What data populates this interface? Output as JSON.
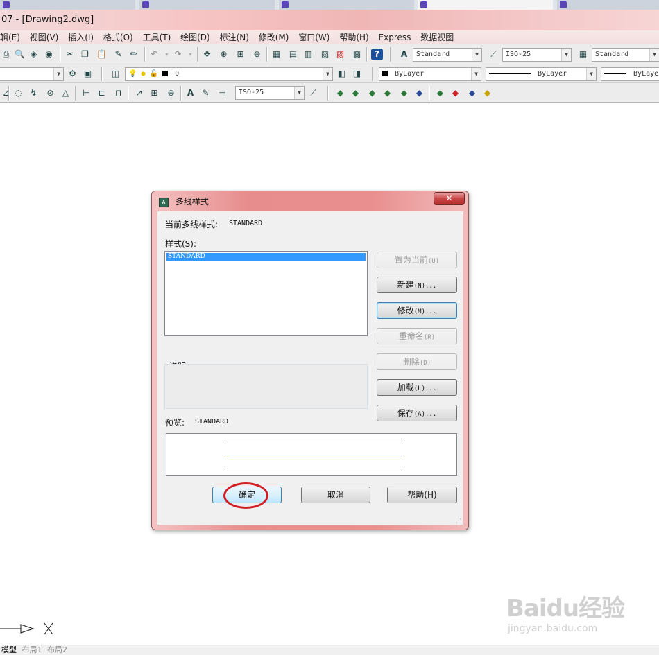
{
  "browser_tabs": [
    {
      "label": "",
      "active": false
    },
    {
      "label": "",
      "active": false
    },
    {
      "label": "",
      "active": false
    },
    {
      "label": "",
      "active": true
    },
    {
      "label": "",
      "active": false
    }
  ],
  "window": {
    "title": "07 - [Drawing2.dwg]"
  },
  "menu": [
    "辑(E)",
    "视图(V)",
    "插入(I)",
    "格式(O)",
    "工具(T)",
    "绘图(D)",
    "标注(N)",
    "修改(M)",
    "窗口(W)",
    "帮助(H)",
    "Express",
    "数据视图"
  ],
  "toolbar": {
    "text_style": "Standard",
    "dim_style": "ISO-25",
    "table_style": "Standard",
    "layer": "0",
    "color": "ByLayer",
    "linetype": "ByLayer",
    "lineweight": "ByLayer",
    "dim_style_2": "ISO-25"
  },
  "dialog": {
    "title": "多线样式",
    "close_glyph": "✕",
    "current_style_label": "当前多线样式:",
    "current_style_value": "STANDARD",
    "styles_label": "样式(S):",
    "styles": [
      "STANDARD"
    ],
    "description_label": "说明:",
    "preview_label": "预览:",
    "preview_value": "STANDARD",
    "buttons": {
      "set_current": {
        "label": "置为当前",
        "acc": "(U)"
      },
      "new": {
        "label": "新建",
        "acc": "(N)..."
      },
      "modify": {
        "label": "修改",
        "acc": "(M)..."
      },
      "rename": {
        "label": "重命名",
        "acc": "(R)"
      },
      "delete": {
        "label": "删除",
        "acc": "(D)"
      },
      "load": {
        "label": "加载",
        "acc": "(L)..."
      },
      "save": {
        "label": "保存",
        "acc": "(A)..."
      },
      "ok": {
        "label": "确定"
      },
      "cancel": {
        "label": "取消"
      },
      "help": {
        "label": "帮助(H)"
      }
    }
  },
  "layout_tabs": [
    "模型",
    "布局1",
    "布局2"
  ],
  "watermark": {
    "logo": "Baidu经验",
    "url": "jingyan.baidu.com"
  },
  "colors": {
    "highlight": "#d21f25",
    "selection": "#3399ff",
    "titlebar": "#f0b6b6"
  }
}
